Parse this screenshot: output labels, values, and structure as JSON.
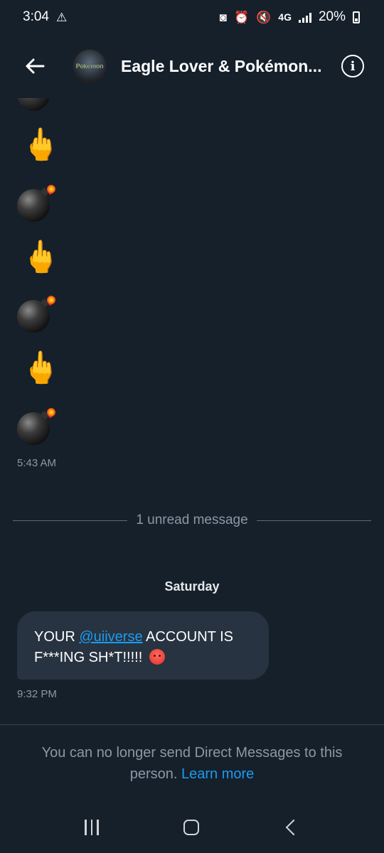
{
  "status_bar": {
    "time": "3:04",
    "network": "4G",
    "battery": "20%"
  },
  "header": {
    "title": "Eagle Lover & Pokémon...",
    "avatar_text": "Pokémon",
    "back_icon": "arrow-left-icon",
    "info_icon": "info-icon"
  },
  "messages": {
    "emojis": [
      "🖕",
      "💣",
      "🖕",
      "💣",
      "🖕",
      "💣"
    ],
    "first_timestamp": "5:43 AM",
    "unread_divider": "1 unread message",
    "day_label": "Saturday",
    "bubble": {
      "prefix": "YOUR ",
      "mention": "@uiiverse",
      "suffix": " ACCOUNT IS F***ING SH*T!!!!! ",
      "emoji": "😡"
    },
    "second_timestamp": "9:32 PM"
  },
  "footer": {
    "notice": "You can no longer send Direct Messages to this person.",
    "learn_more": "Learn more"
  },
  "colors": {
    "background": "#15202b",
    "bubble": "#273340",
    "accent": "#1d9bf0",
    "muted": "#8b98a5"
  }
}
